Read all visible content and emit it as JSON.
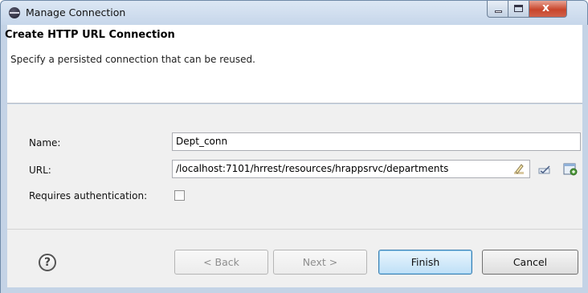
{
  "window": {
    "title": "Manage Connection",
    "close_glyph": "x"
  },
  "banner": {
    "title": "Create HTTP URL Connection",
    "description": "Specify a persisted connection that can be reused."
  },
  "form": {
    "name_label": "Name:",
    "name_value": "Dept_conn",
    "url_label": "URL:",
    "url_value": "/localhost:7101/hrrest/resources/hrappsrvc/departments",
    "auth_label": "Requires authentication:",
    "auth_checked": false,
    "url_icons": [
      "edit-pencil-icon",
      "edit-check-icon",
      "browse-open-icon"
    ]
  },
  "footer": {
    "help_glyph": "?",
    "back_label": "< Back",
    "next_label": "Next >",
    "finish_label": "Finish",
    "cancel_label": "Cancel"
  },
  "colors": {
    "frame": "#c4d3e6",
    "close_button": "#c8462c",
    "default_button": "#bfe0f7"
  }
}
